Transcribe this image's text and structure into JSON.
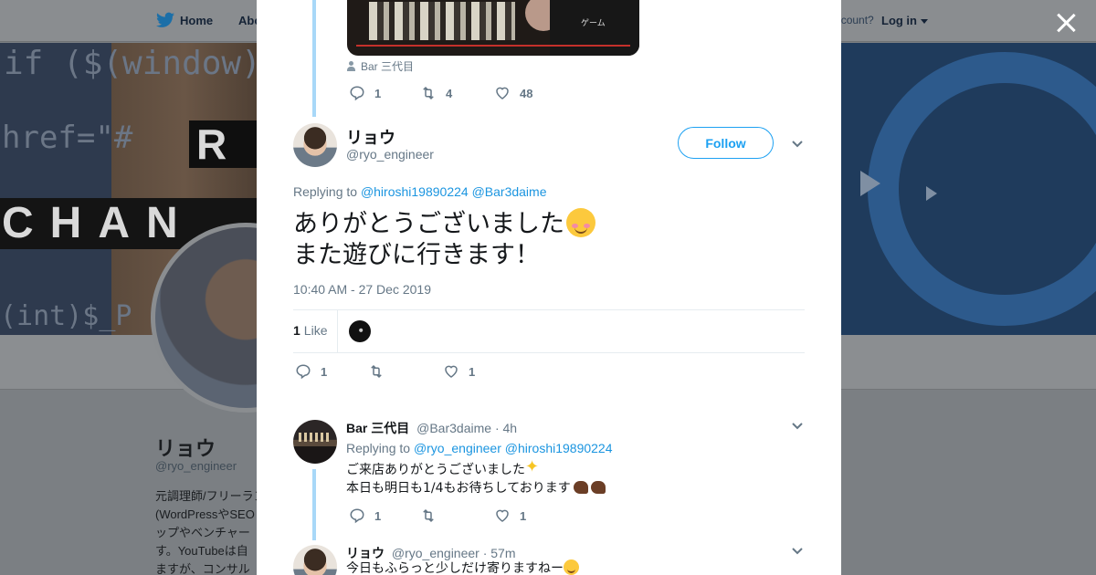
{
  "background": {
    "nav": {
      "home": "Home",
      "about": "Abo",
      "have_account": "Have an account?",
      "login": "Log in"
    },
    "banner": {
      "code_line_1": "if ($(window).s",
      "code_line_2": "href=\"#",
      "code_line_3": "(int)$_P",
      "r_letter": "R",
      "chan_text": "CHAN"
    },
    "profile": {
      "name": "リョウ",
      "handle": "@ryo_engineer",
      "bio_lines": [
        "元調理師/フリーランス",
        "(WordPressやSEO",
        "ップやベンチャー",
        "す。YouTubeは自",
        "ますが、コンサル"
      ]
    }
  },
  "modal": {
    "parent_tweet": {
      "video_caption": "Bar 三代目",
      "shirt_text": "ゲーム",
      "replies": "1",
      "retweets": "4",
      "likes": "48"
    },
    "main_tweet": {
      "name": "リョウ",
      "handle": "@ryo_engineer",
      "follow_label": "Follow",
      "replying_prefix": "Replying to",
      "mention_1": "@hiroshi19890224",
      "mention_2": "@Bar3daime",
      "text_line_1": "ありがとうございました",
      "text_line_2": "また遊びに行きます！",
      "timestamp": "10:40 AM - 27 Dec 2019",
      "like_count": "1",
      "like_label": "Like",
      "replies": "1",
      "retweets": "",
      "likes": "1"
    },
    "replies": [
      {
        "name": "Bar 三代目",
        "handle": "@Bar3daime",
        "time": "· 4h",
        "replying_prefix": "Replying to",
        "mention_1": "@ryo_engineer",
        "mention_2": "@hiroshi19890224",
        "line_1": "ご来店ありがとうございました",
        "line_2": "本日も明日も1/4もお待ちしております",
        "replies": "1",
        "retweets": "",
        "likes": "1"
      },
      {
        "name": "リョウ",
        "handle": "@ryo_engineer",
        "time": "· 57m",
        "line_1": "今日もふらっと少しだけ寄りますねー"
      }
    ]
  },
  "colors": {
    "link": "#1b95e0",
    "follow": "#1da1f2",
    "thread_line": "#a8d8f8",
    "muted": "#657786"
  }
}
